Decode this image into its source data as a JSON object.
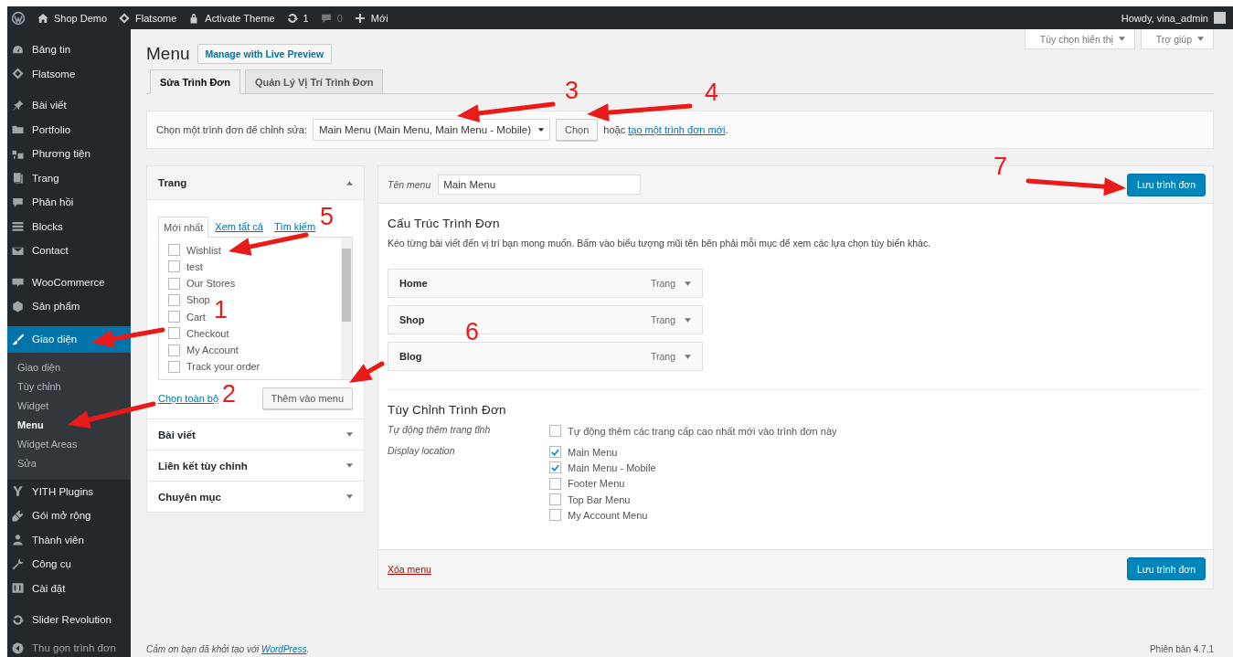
{
  "admin_bar": {
    "items": [
      {
        "label": "Shop Demo"
      },
      {
        "label": "Flatsome"
      },
      {
        "label": "Activate Theme"
      },
      {
        "label": "1"
      },
      {
        "label": "0"
      },
      {
        "label": "Mới"
      }
    ],
    "greeting": "Howdy, vina_admin"
  },
  "sidebar": {
    "groups": [
      [
        {
          "label": "Bảng tin",
          "selected": false
        },
        {
          "label": "Flatsome",
          "selected": false
        }
      ],
      [
        {
          "label": "Bài viết",
          "selected": false
        },
        {
          "label": "Portfolio",
          "selected": false
        },
        {
          "label": "Phương tiện",
          "selected": false
        },
        {
          "label": "Trang",
          "selected": false
        },
        {
          "label": "Phản hồi",
          "selected": false
        },
        {
          "label": "Blocks",
          "selected": false
        },
        {
          "label": "Contact",
          "selected": false
        }
      ],
      [
        {
          "label": "WooCommerce",
          "selected": false
        },
        {
          "label": "Sản phẩm",
          "selected": false
        }
      ],
      [
        {
          "label": "Giao diện",
          "selected": true,
          "children": [
            {
              "label": "Giao diện",
              "selected": false
            },
            {
              "label": "Tùy chỉnh",
              "selected": false
            },
            {
              "label": "Widget",
              "selected": false
            },
            {
              "label": "Menu",
              "selected": true
            },
            {
              "label": "Widget Areas",
              "selected": false
            },
            {
              "label": "Sửa",
              "selected": false
            }
          ]
        },
        {
          "label": "YITH Plugins",
          "selected": false
        },
        {
          "label": "Gói mở rộng",
          "selected": false
        },
        {
          "label": "Thành viên",
          "selected": false
        },
        {
          "label": "Công cụ",
          "selected": false
        },
        {
          "label": "Cài đặt",
          "selected": false
        }
      ],
      [
        {
          "label": "Slider Revolution",
          "selected": false
        }
      ]
    ],
    "collapse": "Thu gọn trình đơn"
  },
  "screen_options": [
    "Tùy chọn hiển thị",
    "Trợ giúp"
  ],
  "heading": {
    "title": "Menu",
    "action": "Manage with Live Preview"
  },
  "tabs": [
    {
      "label": "Sửa Trình Đơn",
      "selected": true
    },
    {
      "label": "Quản Lý Vị Trí Trình Đơn",
      "selected": false
    }
  ],
  "select_bar": {
    "label": "Chọn một trình đơn để chỉnh sửa:",
    "value": "Main Menu (Main Menu, Main Menu - Mobile)",
    "button": "Chọn",
    "or_text": "hoặc",
    "link": "tạo một trình đơn mới",
    "end": "."
  },
  "left_panel": {
    "sections": [
      {
        "title": "Trang",
        "expanded": true,
        "tabs": [
          {
            "label": "Mới nhất",
            "selected": true
          },
          {
            "label": "Xem tất cả",
            "selected": false
          },
          {
            "label": "Tìm kiếm",
            "selected": false
          }
        ],
        "items": [
          {
            "label": "Wishlist",
            "checked": false
          },
          {
            "label": "test",
            "checked": false
          },
          {
            "label": "Our Stores",
            "checked": false
          },
          {
            "label": "Shop",
            "checked": false
          },
          {
            "label": "Cart",
            "checked": false
          },
          {
            "label": "Checkout",
            "checked": false
          },
          {
            "label": "My Account",
            "checked": false
          },
          {
            "label": "Track your order",
            "checked": false
          }
        ],
        "select_all": "Chọn toàn bộ",
        "add_button": "Thêm vào menu"
      },
      {
        "title": "Bài viết",
        "expanded": false
      },
      {
        "title": "Liên kết tùy chỉnh",
        "expanded": false
      },
      {
        "title": "Chuyên mục",
        "expanded": false
      }
    ]
  },
  "editor": {
    "name_label": "Tên menu",
    "name_value": "Main Menu",
    "save": "Lưu trình đơn",
    "structure_title": "Cấu Trúc Trình Đơn",
    "structure_hint": "Kéo từng bài viết đến vị trí bạn mong muốn. Bấm vào biểu tượng mũi tên bên phải mỗi mục để xem các lựa chọn tùy biến khác.",
    "menu_items": [
      {
        "title": "Home",
        "type": "Trang"
      },
      {
        "title": "Shop",
        "type": "Trang"
      },
      {
        "title": "Blog",
        "type": "Trang"
      }
    ],
    "settings_title": "Tùy Chỉnh Trình Đơn",
    "settings": [
      {
        "label": "Tự động thêm trang tĩnh",
        "options": [
          {
            "label": "Tự động thêm các trang cấp cao nhất mới vào trình đơn này",
            "checked": false
          }
        ]
      },
      {
        "label": "Display location",
        "options": [
          {
            "label": "Main Menu",
            "checked": true
          },
          {
            "label": "Main Menu - Mobile",
            "checked": true
          },
          {
            "label": "Footer Menu",
            "checked": false
          },
          {
            "label": "Top Bar Menu",
            "checked": false
          },
          {
            "label": "My Account Menu",
            "checked": false
          }
        ]
      }
    ],
    "delete": "Xóa menu",
    "save_bottom": "Lưu trình đơn"
  },
  "footer": {
    "thanks": "Cảm ơn bạn đã khởi tạo với",
    "link": "WordPress",
    "end": ".",
    "version": "Phiên bản 4.7.1"
  },
  "annotations": [
    {
      "label": "1"
    },
    {
      "label": "2"
    },
    {
      "label": "3"
    },
    {
      "label": "4"
    },
    {
      "label": "5"
    },
    {
      "label": "6"
    },
    {
      "label": "7"
    }
  ]
}
